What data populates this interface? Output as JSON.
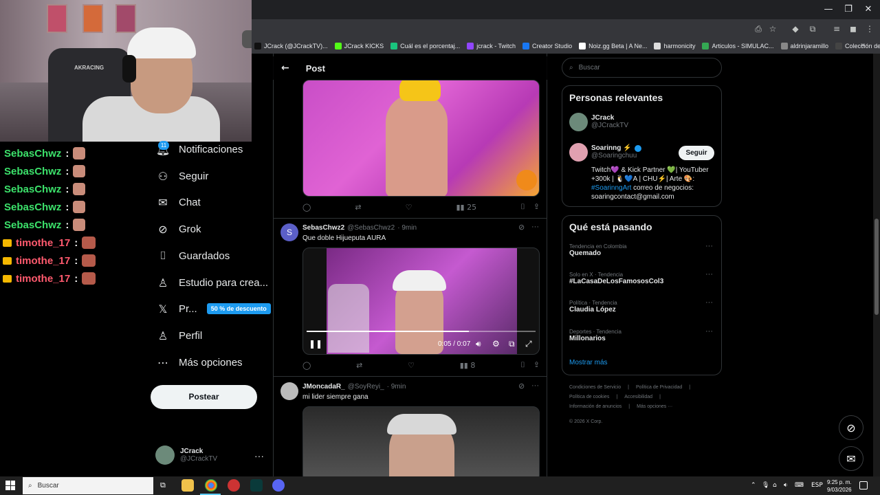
{
  "browser": {
    "bookmarks": [
      {
        "label": "JCrack (@JCrackTV)...",
        "color": "#111111"
      },
      {
        "label": "JCrack KICKS",
        "color": "#53fc18"
      },
      {
        "label": "Cuál es el porcentaj...",
        "color": "#19c37d"
      },
      {
        "label": "jcrack - Twitch",
        "color": "#9146ff"
      },
      {
        "label": "Creator Studio",
        "color": "#1877f2"
      },
      {
        "label": "Noiz.gg Beta | A Ne...",
        "color": "#ffffff"
      },
      {
        "label": "harmonicity",
        "color": "#dddddd"
      },
      {
        "label": "Articulos - SIMULAC...",
        "color": "#34a853"
      },
      {
        "label": "aldrinjaramillo",
        "color": "#888888"
      },
      {
        "label": "Colección de M_blei...",
        "color": "#444444"
      }
    ]
  },
  "chat": [
    {
      "user": "SebasChwz",
      "sep": ":",
      "color": "#3ce26b"
    },
    {
      "user": "SebasChwz",
      "sep": ":",
      "color": "#3ce26b"
    },
    {
      "user": "SebasChwz",
      "sep": ":",
      "color": "#3ce26b"
    },
    {
      "user": "SebasChwz",
      "sep": ":",
      "color": "#3ce26b"
    },
    {
      "user": "SebasChwz",
      "sep": ":",
      "color": "#3ce26b"
    },
    {
      "user": "timothe_17",
      "sep": ":",
      "color": "#ff5a6e"
    },
    {
      "user": "timothe_17",
      "sep": ":",
      "color": "#ff5a6e"
    },
    {
      "user": "timothe_17",
      "sep": ":",
      "color": "#ff5a6e"
    }
  ],
  "nav": {
    "notif_badge": "11",
    "items": [
      {
        "label": "Notificaciones",
        "icon": "bell-icon"
      },
      {
        "label": "Seguir",
        "icon": "add-user-icon"
      },
      {
        "label": "Chat",
        "icon": "mail-icon"
      },
      {
        "label": "Grok",
        "icon": "grok-icon"
      },
      {
        "label": "Guardados",
        "icon": "bookmark-icon"
      },
      {
        "label": "Estudio para crea...",
        "icon": "studio-icon"
      },
      {
        "label": "Pr...",
        "icon": "x-logo-icon"
      },
      {
        "label": "Perfil",
        "icon": "person-icon"
      },
      {
        "label": "Más opciones",
        "icon": "more-circle-icon"
      }
    ],
    "promo": "50 % de descuento",
    "post_button": "Postear",
    "account": {
      "name": "JCrack",
      "handle": "@JCrackTV"
    }
  },
  "main": {
    "title": "Post",
    "tweet1": {
      "views": "25"
    },
    "tweet2": {
      "avatar_letter": "S",
      "name": "SebasChwz2",
      "handle": "@SebasChwz2",
      "time": "· 9min",
      "text": "Que doble Hijueputa AURA",
      "video_time": "0:05 / 0:07",
      "video_progress": 0.71,
      "views": "8"
    },
    "tweet3": {
      "name": "JMoncadaR_",
      "handle": "@SoyReyi_",
      "time": "· 9min",
      "text": "mi lider siempre gana"
    }
  },
  "right": {
    "search_placeholder": "Buscar",
    "relevant_title": "Personas relevantes",
    "people": [
      {
        "name": "JCrack",
        "handle": "@JCrackTV"
      },
      {
        "name": "Soarinng ⚡",
        "handle": "@Soaringchuu",
        "follow": "Seguir",
        "bio1": "Twitch💜 & Kick Partner 💚| YouTuber",
        "bio2": "+300k | 🐧💙A | CHU⚡| Arte 🎨:",
        "bio_tag": "#SoarinngArt",
        "bio3": " correo de negocios:",
        "bio4": "soaringcontact@gmail.com"
      }
    ],
    "trends_title": "Qué está pasando",
    "trends": [
      {
        "category": "Tendencia en Colombia",
        "name": "Quemado"
      },
      {
        "category": "Solo en X · Tendencia",
        "name": "#LaCasaDeLosFamososCol3"
      },
      {
        "category": "Política · Tendencia",
        "name": "Claudia López"
      },
      {
        "category": "Deportes · Tendencia",
        "name": "Millonarios"
      }
    ],
    "show_more": "Mostrar más",
    "footer": {
      "l1a": "Condiciones de Servicio",
      "l1b": "Política de Privacidad",
      "l2a": "Política de cookies",
      "l2b": "Accesibilidad",
      "l3a": "Información de anuncios",
      "l3b": "Más opciones ···",
      "copy": "© 2026 X Corp."
    }
  },
  "taskbar": {
    "search": "Buscar",
    "lang": "ESP",
    "time": "9:25 p. m.",
    "date": "9/03/2026"
  },
  "colors": {
    "accent": "#1d9bf0",
    "chat_green": "#3ce26b",
    "chat_red": "#ff5a6e"
  }
}
